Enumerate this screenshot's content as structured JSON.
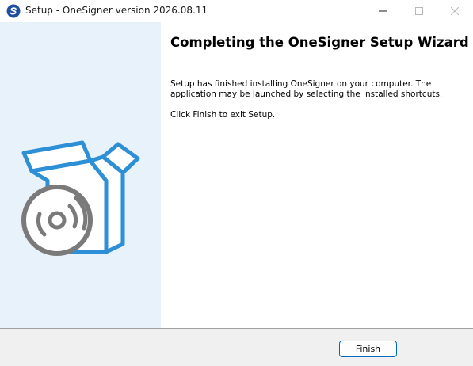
{
  "window": {
    "title": "Setup - OneSigner version 2026.08.11",
    "minimize_icon": "minimize-icon",
    "maximize_icon": "maximize-icon",
    "close_icon": "close-icon",
    "app_icon": "onesigner-logo-icon"
  },
  "sidebar": {
    "illustration": "install-box-with-disc-icon"
  },
  "content": {
    "heading": "Completing the OneSigner Setup Wizard",
    "body": "Setup has finished installing OneSigner on your computer. The application may be launched by selecting the installed shortcuts.",
    "exit_instructions": "Click Finish to exit Setup."
  },
  "footer": {
    "finish_label": "Finish"
  },
  "colors": {
    "accent": "#0067c0",
    "box_blue": "#2d8fd5",
    "disc_gray": "#7a7a7a",
    "sidebar_bg": "#e8f2fa"
  }
}
